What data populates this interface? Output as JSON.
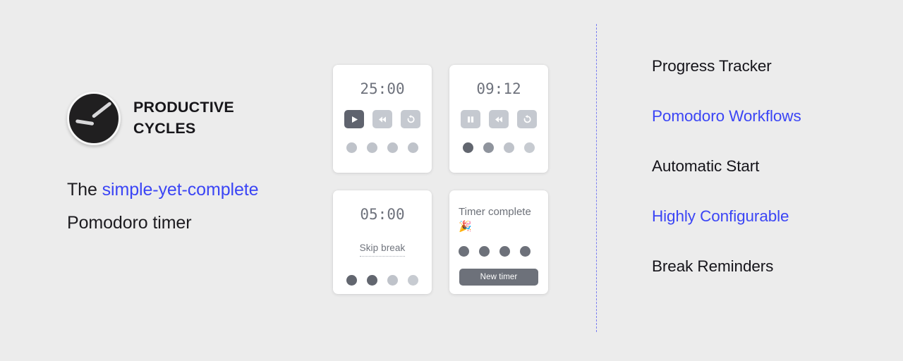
{
  "brand": {
    "logo_icon": "clock-icon",
    "name_line1": "PRODUCTIVE",
    "name_line2": "CYCLES",
    "tagline_prefix": "The ",
    "tagline_accent": "simple-yet-complete",
    "tagline_line2": "Pomodoro timer",
    "accent_color": "#3b45f5"
  },
  "cards": [
    {
      "id": "focus-timer-idle",
      "time": "25:00",
      "controls": [
        {
          "name": "play-icon",
          "label": "Play",
          "state": "primary"
        },
        {
          "name": "rewind-icon",
          "label": "Rewind",
          "state": "muted"
        },
        {
          "name": "reset-icon",
          "label": "Reset",
          "state": "muted"
        }
      ],
      "dots": [
        "light",
        "light",
        "light",
        "light"
      ]
    },
    {
      "id": "focus-timer-running",
      "time": "09:12",
      "controls": [
        {
          "name": "pause-icon",
          "label": "Pause",
          "state": "muted"
        },
        {
          "name": "rewind-icon",
          "label": "Rewind",
          "state": "muted"
        },
        {
          "name": "reset-icon",
          "label": "Reset",
          "state": "muted"
        }
      ],
      "dots": [
        "dark",
        "mid",
        "light",
        "lighter"
      ]
    },
    {
      "id": "break-timer",
      "time": "05:00",
      "skip_label": "Skip break",
      "dots": [
        "dark",
        "dark",
        "light",
        "lighter"
      ]
    },
    {
      "id": "timer-complete",
      "complete_text": "Timer complete 🎉",
      "dots": [
        "solid",
        "solid",
        "solid",
        "solid"
      ],
      "new_timer_label": "New timer"
    }
  ],
  "features": [
    {
      "label": "Progress Tracker",
      "highlighted": false
    },
    {
      "label": "Pomodoro Workflows",
      "highlighted": true
    },
    {
      "label": "Automatic Start",
      "highlighted": false
    },
    {
      "label": "Highly Configurable",
      "highlighted": true
    },
    {
      "label": "Break Reminders",
      "highlighted": false
    }
  ]
}
